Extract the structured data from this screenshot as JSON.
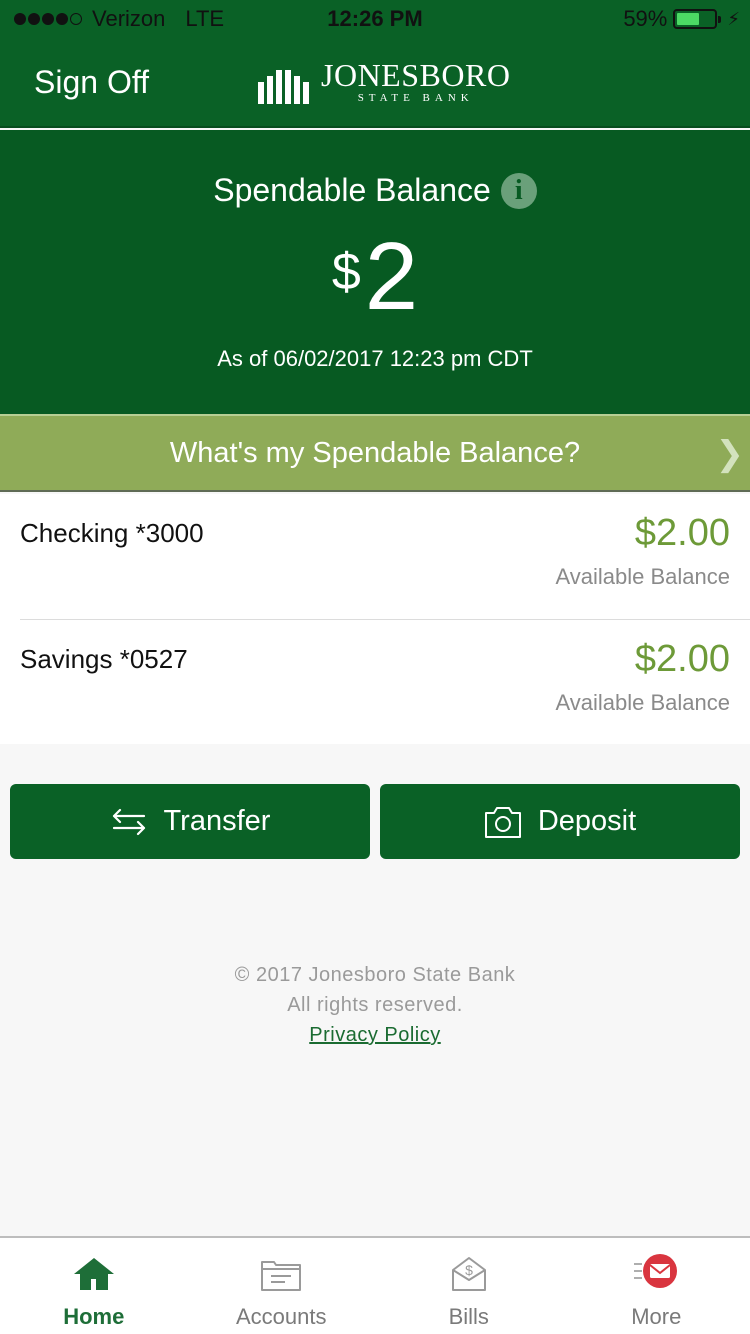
{
  "status_bar": {
    "signal_bars_filled": 4,
    "signal_bars_total": 5,
    "carrier": "Verizon",
    "network": "LTE",
    "time": "12:26 PM",
    "battery_percent_label": "59%",
    "battery_level": 0.59,
    "charging_icon": "lightning-bolt-icon"
  },
  "header": {
    "sign_off_label": "Sign Off",
    "logo_name": "JONESBORO",
    "logo_subtitle": "STATE BANK"
  },
  "hero": {
    "title": "Spendable Balance",
    "info_icon": "i",
    "currency_symbol": "$",
    "amount": "2",
    "as_of": "As of  06/02/2017 12:23 pm CDT"
  },
  "spendable_link": {
    "label": "What's my Spendable Balance?",
    "chevron": "❯"
  },
  "accounts": [
    {
      "name": "Checking *3000",
      "amount": "$2.00",
      "label": "Available Balance"
    },
    {
      "name": "Savings *0527",
      "amount": "$2.00",
      "label": "Available Balance"
    }
  ],
  "actions": {
    "transfer_label": "Transfer",
    "deposit_label": "Deposit"
  },
  "footer": {
    "copyright": "© 2017 Jonesboro State Bank",
    "rights": "All rights reserved.",
    "privacy_label": "Privacy Policy"
  },
  "tabs": [
    {
      "label": "Home",
      "icon": "home-icon",
      "active": true
    },
    {
      "label": "Accounts",
      "icon": "folder-icon",
      "active": false
    },
    {
      "label": "Bills",
      "icon": "bill-envelope-icon",
      "active": false
    },
    {
      "label": "More",
      "icon": "more-mail-icon",
      "active": false
    }
  ],
  "colors": {
    "brand_green": "#0a6126",
    "hero_green": "#075a22",
    "link_bar_green": "#8fab58",
    "amount_green": "#6d9a38",
    "alert_red": "#d9353f"
  }
}
